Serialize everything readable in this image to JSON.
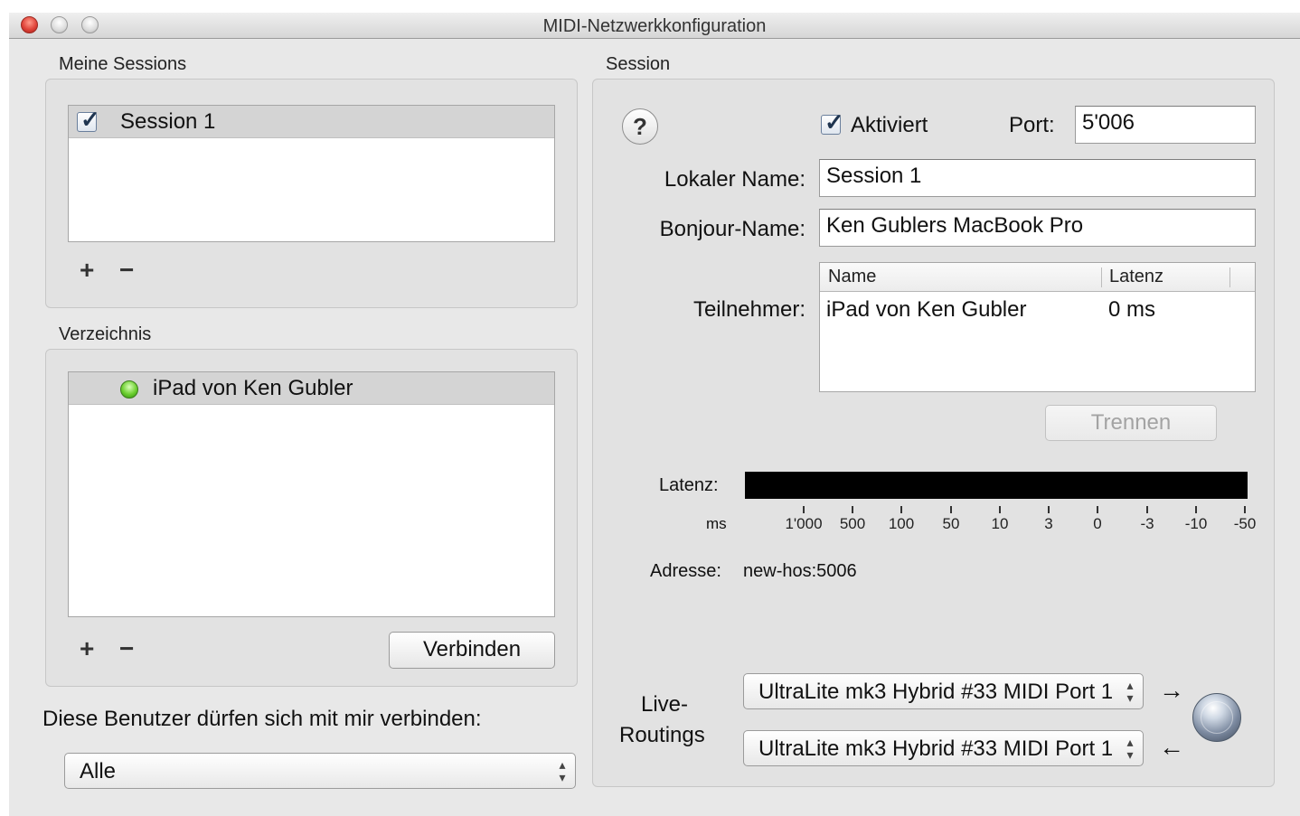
{
  "window": {
    "title": "MIDI-Netzwerkkonfiguration"
  },
  "sessions": {
    "label": "Meine Sessions",
    "items": [
      {
        "label": "Session 1",
        "checked": true
      }
    ],
    "add_label": "+",
    "remove_label": "−"
  },
  "directory": {
    "label": "Verzeichnis",
    "items": [
      {
        "label": "iPad von Ken Gubler",
        "status": "online"
      }
    ],
    "add_label": "+",
    "remove_label": "−",
    "connect_label": "Verbinden"
  },
  "permissions": {
    "label": "Diese Benutzer dürfen sich mit mir verbinden:",
    "selected": "Alle"
  },
  "session": {
    "label": "Session",
    "help_label": "?",
    "enabled_label": "Aktiviert",
    "enabled": true,
    "port_label": "Port:",
    "port_value": "5'006",
    "local_name_label": "Lokaler Name:",
    "local_name_value": "Session 1",
    "bonjour_name_label": "Bonjour-Name:",
    "bonjour_name_value": "Ken Gublers MacBook Pro",
    "participants_label": "Teilnehmer:",
    "participants_columns": {
      "name": "Name",
      "latency": "Latenz"
    },
    "participants": [
      {
        "name": "iPad von Ken Gubler",
        "latency": "0 ms"
      }
    ],
    "disconnect_label": "Trennen",
    "latency_label": "Latenz:",
    "latency_unit": "ms",
    "latency_ticks": [
      "1'000",
      "500",
      "100",
      "50",
      "10",
      "3",
      "0",
      "-3",
      "-10",
      "-50"
    ],
    "address_label": "Adresse:",
    "address_value": "new-hos:5006",
    "live_routing_label_1": "Live-",
    "live_routing_label_2": "Routings",
    "routing_out": "UltraLite mk3 Hybrid #33 MIDI Port 1",
    "routing_in": "UltraLite mk3 Hybrid #33 MIDI Port 1",
    "arrow_out": "→",
    "arrow_in": "←",
    "icon": "network-globe-icon"
  }
}
